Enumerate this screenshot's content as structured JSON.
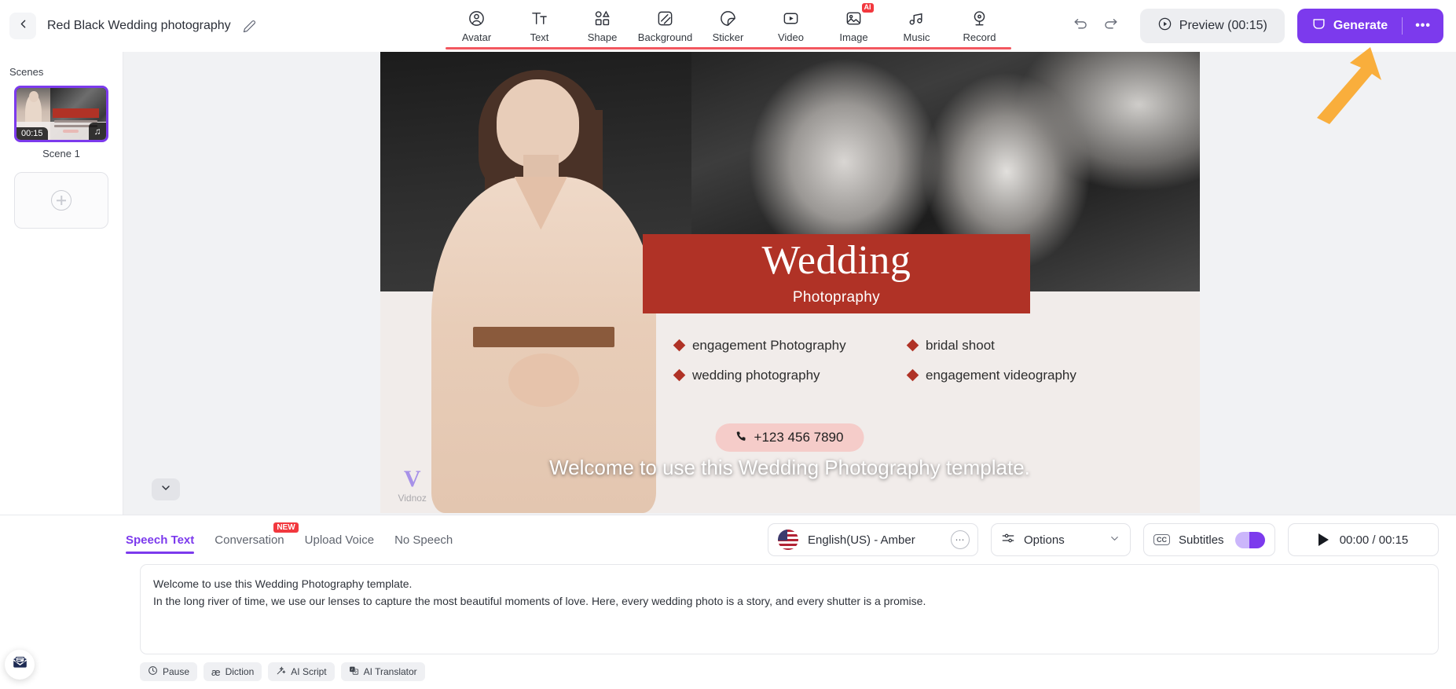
{
  "header": {
    "back_icon": "chevron-left-icon",
    "project_title": "Red Black Wedding photography",
    "edit_icon": "pencil-icon",
    "undo_icon": "undo-icon",
    "redo_icon": "redo-icon",
    "preview_label": "Preview (00:15)",
    "generate_label": "Generate",
    "generate_more_label": "•••",
    "accent_purple": "#7c3aed",
    "accent_red": "#f2575f"
  },
  "tools": [
    {
      "label": "Avatar",
      "icon": "avatar-icon",
      "badge": ""
    },
    {
      "label": "Text",
      "icon": "text-icon",
      "badge": ""
    },
    {
      "label": "Shape",
      "icon": "shape-icon",
      "badge": ""
    },
    {
      "label": "Background",
      "icon": "background-icon",
      "badge": ""
    },
    {
      "label": "Sticker",
      "icon": "sticker-icon",
      "badge": ""
    },
    {
      "label": "Video",
      "icon": "video-icon",
      "badge": ""
    },
    {
      "label": "Image",
      "icon": "image-icon",
      "badge": "AI"
    },
    {
      "label": "Music",
      "icon": "music-icon",
      "badge": ""
    },
    {
      "label": "Record",
      "icon": "record-icon",
      "badge": ""
    }
  ],
  "scenes": {
    "title": "Scenes",
    "items": [
      {
        "label": "Scene 1",
        "duration": "00:15",
        "music_icon": "music-note-icon",
        "selected": true
      }
    ],
    "add_icon": "plus-circle-icon"
  },
  "canvas": {
    "banner_title": "Wedding",
    "banner_subtitle": "Photopraphy",
    "banner_color": "#b03226",
    "services": [
      "engagement Photography",
      "bridal shoot",
      "wedding photography",
      "engagement videography"
    ],
    "phone_icon": "phone-icon",
    "phone": "+123 456 7890",
    "subtitle_text": "Welcome to use this Wedding Photography template.",
    "watermark_logo": "V",
    "watermark_text": "Vidnoz",
    "collapse_icon": "chevron-down-icon"
  },
  "bottom": {
    "tabs": [
      {
        "label": "Speech Text",
        "active": true,
        "badge": ""
      },
      {
        "label": "Conversation",
        "active": false,
        "badge": "NEW"
      },
      {
        "label": "Upload Voice",
        "active": false,
        "badge": ""
      },
      {
        "label": "No Speech",
        "active": false,
        "badge": ""
      }
    ],
    "voice": {
      "flag_icon": "us-flag-icon",
      "name": "English(US) - Amber",
      "more_icon": "more-dots-icon"
    },
    "options": {
      "icon": "sliders-icon",
      "label": "Options",
      "chevron_icon": "chevron-down-icon"
    },
    "subtitles": {
      "icon": "cc-icon",
      "label": "Subtitles",
      "toggle_on": true
    },
    "player": {
      "play_icon": "play-icon",
      "time": "00:00 / 00:15"
    },
    "script": {
      "line1": "Welcome to use this Wedding Photography template.",
      "line2": "In the long river of time, we use our lenses to capture the most beautiful moments of love. Here, every wedding photo is a story, and every shutter is a promise."
    },
    "chips": [
      {
        "label": "Pause",
        "icon": "clock-icon"
      },
      {
        "label": "Diction",
        "icon": "phonetic-icon"
      },
      {
        "label": "AI Script",
        "icon": "magic-wand-icon"
      },
      {
        "label": "AI Translator",
        "icon": "translate-icon"
      }
    ]
  },
  "floating": {
    "feedback_icon": "envelope-icon",
    "annotation_arrow_icon": "arrow-up-icon",
    "annotation_color": "#f9ae3c"
  }
}
